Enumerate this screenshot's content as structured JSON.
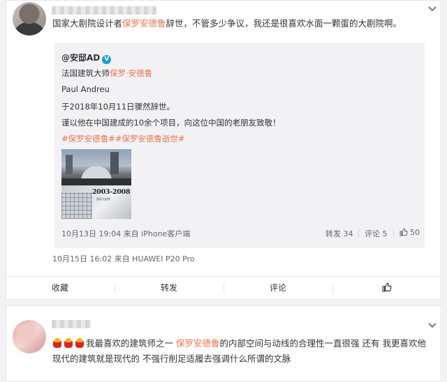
{
  "post1": {
    "text_pre": "国家大剧院设计者",
    "text_hl": "保罗安德鲁",
    "text_post": "辞世，不管多少争议，我还是很喜欢水面一颗蛋的大剧院啊。",
    "meta": "10月15日 16:02 来自 HUAWEI P20 Pro"
  },
  "quote": {
    "author": "@安邸AD",
    "verified": "V",
    "line1_pre": "法国建筑大师",
    "line1_hl": "保罗·安德鲁",
    "line2": "Paul Andreu",
    "line3": "于2018年10月11日骤然辞世。",
    "line4": "谨以他在中国建成的10余个项目，向这位中国的老朋友致敬！",
    "hashtags": "#保罗安德鲁##保罗安德鲁逝世#",
    "image_year": "2003-2008",
    "image_caption": "国家大剧院",
    "meta": "10月13日 19:04 来自 iPhone客户端",
    "repost": "转发 34",
    "comment": "评论 5",
    "like": "50"
  },
  "actions": {
    "favorite": "收藏",
    "repost": "转发",
    "comment": "评论"
  },
  "comment1": {
    "text_pre": "我最喜欢的建筑师之一 ",
    "text_hl": "保罗安德鲁",
    "text_post": "的内部空间与动线的合理性一直很强 还有 我更喜欢他现代的建筑就是现代的 不强行削足适履去强调什么所谓的文脉"
  },
  "colors": {
    "accent": "#eb7350",
    "verified": "#1e9ad6"
  }
}
